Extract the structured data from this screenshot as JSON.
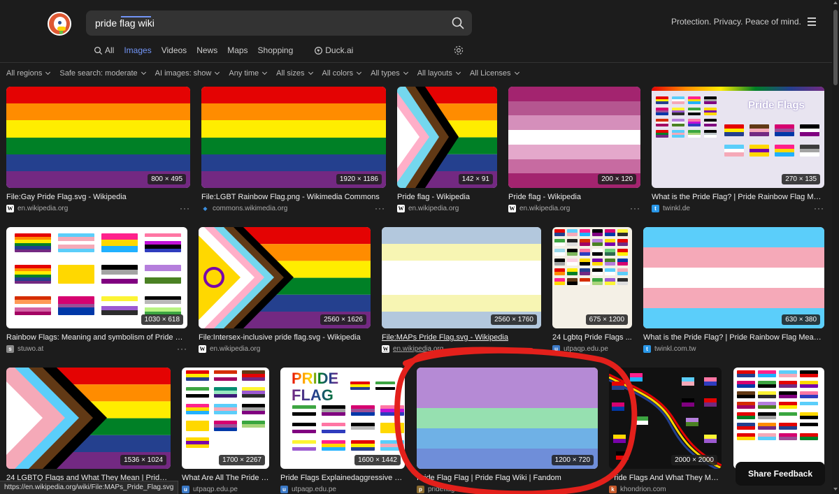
{
  "search": {
    "query": "pride flag wiki"
  },
  "header": {
    "tagline": "Protection. Privacy. Peace of mind."
  },
  "tabs": [
    {
      "label": "All"
    },
    {
      "label": "Images"
    },
    {
      "label": "Videos"
    },
    {
      "label": "News"
    },
    {
      "label": "Maps"
    },
    {
      "label": "Shopping"
    },
    {
      "label": "Duck.ai"
    }
  ],
  "filters": [
    "All regions",
    "Safe search: moderate",
    "AI images: show",
    "Any time",
    "All sizes",
    "All colors",
    "All types",
    "All layouts",
    "All Licenses"
  ],
  "results": [
    {
      "title": "File:Gay Pride Flag.svg - Wikipedia",
      "source": "en.wikipedia.org",
      "dims": "800 × 495",
      "favicon": "W",
      "colors": [
        "#e40303",
        "#ff8c00",
        "#ffed00",
        "#008026",
        "#24408e",
        "#732982"
      ]
    },
    {
      "title": "File:LGBT Rainbow Flag.png - Wikimedia Commons",
      "source": "commons.wikimedia.org",
      "dims": "1920 × 1186",
      "favicon": "C",
      "colors": [
        "#e40303",
        "#ff8c00",
        "#ffed00",
        "#008026",
        "#24408e",
        "#732982"
      ]
    },
    {
      "title": "Pride flag - Wikipedia",
      "source": "en.wikipedia.org",
      "dims": "142 × 91",
      "favicon": "W",
      "colors": [
        "#e40303",
        "#ff8c00",
        "#ffed00",
        "#008026",
        "#24408e",
        "#732982"
      ]
    },
    {
      "title": "Pride flag - Wikipedia",
      "source": "en.wikipedia.org",
      "dims": "200 × 120",
      "favicon": "W",
      "colors": [
        "#a30262",
        "#b55690",
        "#d162a4",
        "#ffffff",
        "#ff9a56",
        "#d52d00"
      ]
    },
    {
      "title": "What is the Pride Flag? | Pride Rainbow Flag Meaning...",
      "source": "twinkl.de",
      "dims": "270 × 135",
      "favicon": "t"
    },
    {
      "title": "Rainbow Flags: Meaning and symbolism of Pride Flag...",
      "source": "stuwo.at",
      "dims": "1030 × 618",
      "favicon": "s"
    },
    {
      "title": "File:Intersex-inclusive pride flag.svg - Wikipedia",
      "source": "en.wikipedia.org",
      "dims": "2560 × 1626",
      "favicon": "W",
      "colors": [
        "#e40303",
        "#ff8c00",
        "#ffed00",
        "#008026",
        "#24408e",
        "#732982"
      ]
    },
    {
      "title": "File:MAPs Pride Flag.svg - Wikipedia",
      "source": "en.wikipedia.org",
      "dims": "2560 × 1760",
      "favicon": "W",
      "colors": [
        "#b3c8dd",
        "#f7f5b3",
        "#ffffff",
        "#ffffff",
        "#f7f5b3",
        "#b3c8dd"
      ]
    },
    {
      "title": "24 Lgbtq Pride Flags ...",
      "source": "utpaqp.edu.pe",
      "dims": "675 × 1200",
      "favicon": "u"
    },
    {
      "title": "What is the Pride Flag? | Pride Rainbow Flag Meaning...",
      "source": "twinkl.com.tw",
      "dims": "630 × 380",
      "favicon": "t",
      "colors": [
        "#5bcefa",
        "#f5a9b8",
        "#ffffff",
        "#f5a9b8",
        "#5bcefa"
      ]
    },
    {
      "title": "24 LGBTQ Flags and What They Mean | Pride Mo...",
      "source": "",
      "dims": "1536 × 1024",
      "favicon": "",
      "colors": [
        "#e40303",
        "#ff8c00",
        "#ffed00",
        "#008026",
        "#24408e",
        "#732982"
      ]
    },
    {
      "title": "What Are All The Pride Fl...",
      "source": "utpaqp.edu.pe",
      "dims": "1700 × 2267",
      "favicon": "u"
    },
    {
      "title": "Pride Flags Explainedaggressive Pri...",
      "source": "utpaqp.edu.pe",
      "dims": "1600 × 1442",
      "favicon": "u"
    },
    {
      "title": "Pride Flag Flag | Pride Flag Wiki | Fandom",
      "source": "prideflag...",
      "dims": "1200 × 720",
      "favicon": "p",
      "colors": [
        "#b58ad5",
        "#b58ad5",
        "#96e0b0",
        "#6fb1e6",
        "#6f8ed9"
      ]
    },
    {
      "title": "Pride Flags And What They Mea...",
      "source": "khondrion.com",
      "dims": "2000 × 2000",
      "favicon": "k"
    },
    {
      "title": "",
      "source": "",
      "dims": "",
      "favicon": ""
    }
  ],
  "pride_flag_text": {
    "line1": "PRIDE",
    "line2": "FLAG"
  },
  "pride_flags_header": "Pride Flags",
  "status_url": "https://en.wikipedia.org/wiki/File:MAPs_Pride_Flag.svg",
  "share_feedback": "Share Feedback"
}
